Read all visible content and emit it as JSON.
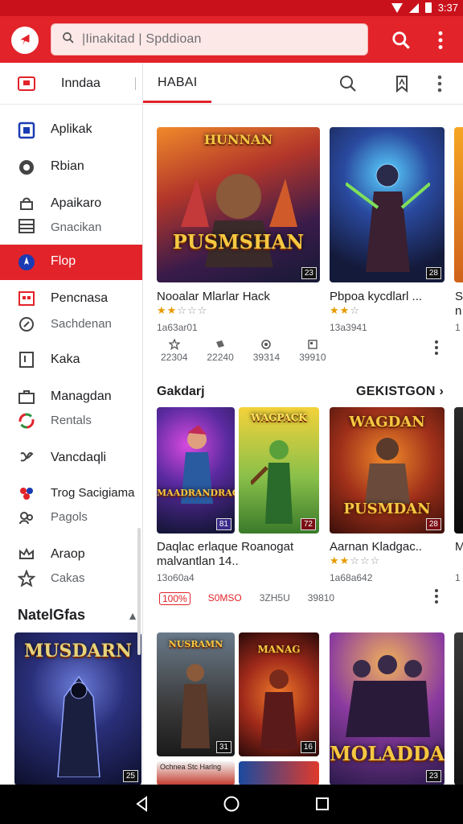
{
  "status_bar": {
    "time": "3:37"
  },
  "app_bar": {
    "search_placeholder": "|Iinakitad | Spddioan"
  },
  "sidebar": {
    "header_label": "Inndaa",
    "items": [
      {
        "label": "Aplikak",
        "icon": "square-icon"
      },
      {
        "label": "Rbian",
        "icon": "compass-icon"
      },
      {
        "label": "Apaikaro",
        "sub": "Gnacikan",
        "icon": "bag-icon"
      },
      {
        "label": "Flop",
        "icon": "rocket-icon",
        "active": true
      },
      {
        "label": "Pencnasa",
        "sub": "Sachdenan",
        "icon": "calendar-icon"
      },
      {
        "label": "Kaka",
        "icon": "book-icon"
      },
      {
        "label": "Managdan",
        "sub": "Rentals",
        "icon": "briefcase-icon"
      },
      {
        "label": "Vancdaqli",
        "icon": "puzzle-icon"
      },
      {
        "label": "Trog Sacigiama",
        "sub": "Pagols",
        "icon": "people-icon"
      },
      {
        "label": "Araop",
        "sub": "Cakas",
        "icon": "star-outline-icon"
      }
    ],
    "section_label": "NatelGfas"
  },
  "main": {
    "tab_label": "HABAI",
    "row1": [
      {
        "title": "Nooalar Mlarlar Hack",
        "stars": 2,
        "meta": "1a63ar01",
        "badge": "23",
        "art_title": "PUSMSHAN"
      },
      {
        "title": "Pbpoa kycdlarl ...",
        "stars": 2,
        "meta": "13a3941",
        "badge": "28"
      },
      {
        "title": "S",
        "meta": "1",
        "sub": "n"
      }
    ],
    "row1_stats": [
      {
        "icon": "star-stat-icon",
        "value": "22304"
      },
      {
        "icon": "copy-stat-icon",
        "value": "22240"
      },
      {
        "icon": "circle-stat-icon",
        "value": "39314"
      },
      {
        "icon": "doc-stat-icon",
        "value": "39910"
      }
    ],
    "section": {
      "title": "Gakdarj",
      "more": "GEKISTGON"
    },
    "row2": [
      {
        "title": "Daqlac erlaque Roanogat",
        "subtitle": "malvantlan 14..",
        "meta": "13o60a4",
        "badge": "81",
        "art_title": "MAADRANDRAGE"
      },
      {
        "badge": "72",
        "art_title": "WAGPACK"
      },
      {
        "title": "Aarnan Kladgac..",
        "stars": 2,
        "meta": "1a68a642",
        "badge": "28",
        "art_title": "PUSMDAN"
      },
      {
        "title": "M",
        "meta": "1"
      }
    ],
    "row2_stats": [
      "100%",
      "S0MSO",
      "3ZH5U",
      "39810"
    ],
    "row3": [
      {
        "badge": "31",
        "art_title": "NUSRAMN"
      },
      {
        "badge": "16",
        "art_title": "MANAG"
      },
      {
        "badge": "23",
        "art_title": "MOLADDAS"
      }
    ],
    "row4_title": "Ochnea Stc Harlng"
  },
  "sidebar_art": {
    "badge": "25",
    "art_title": "MUSDARN"
  },
  "colors": {
    "accent": "#e2232a",
    "status_bar": "#c9111b",
    "star": "#e69b00"
  }
}
